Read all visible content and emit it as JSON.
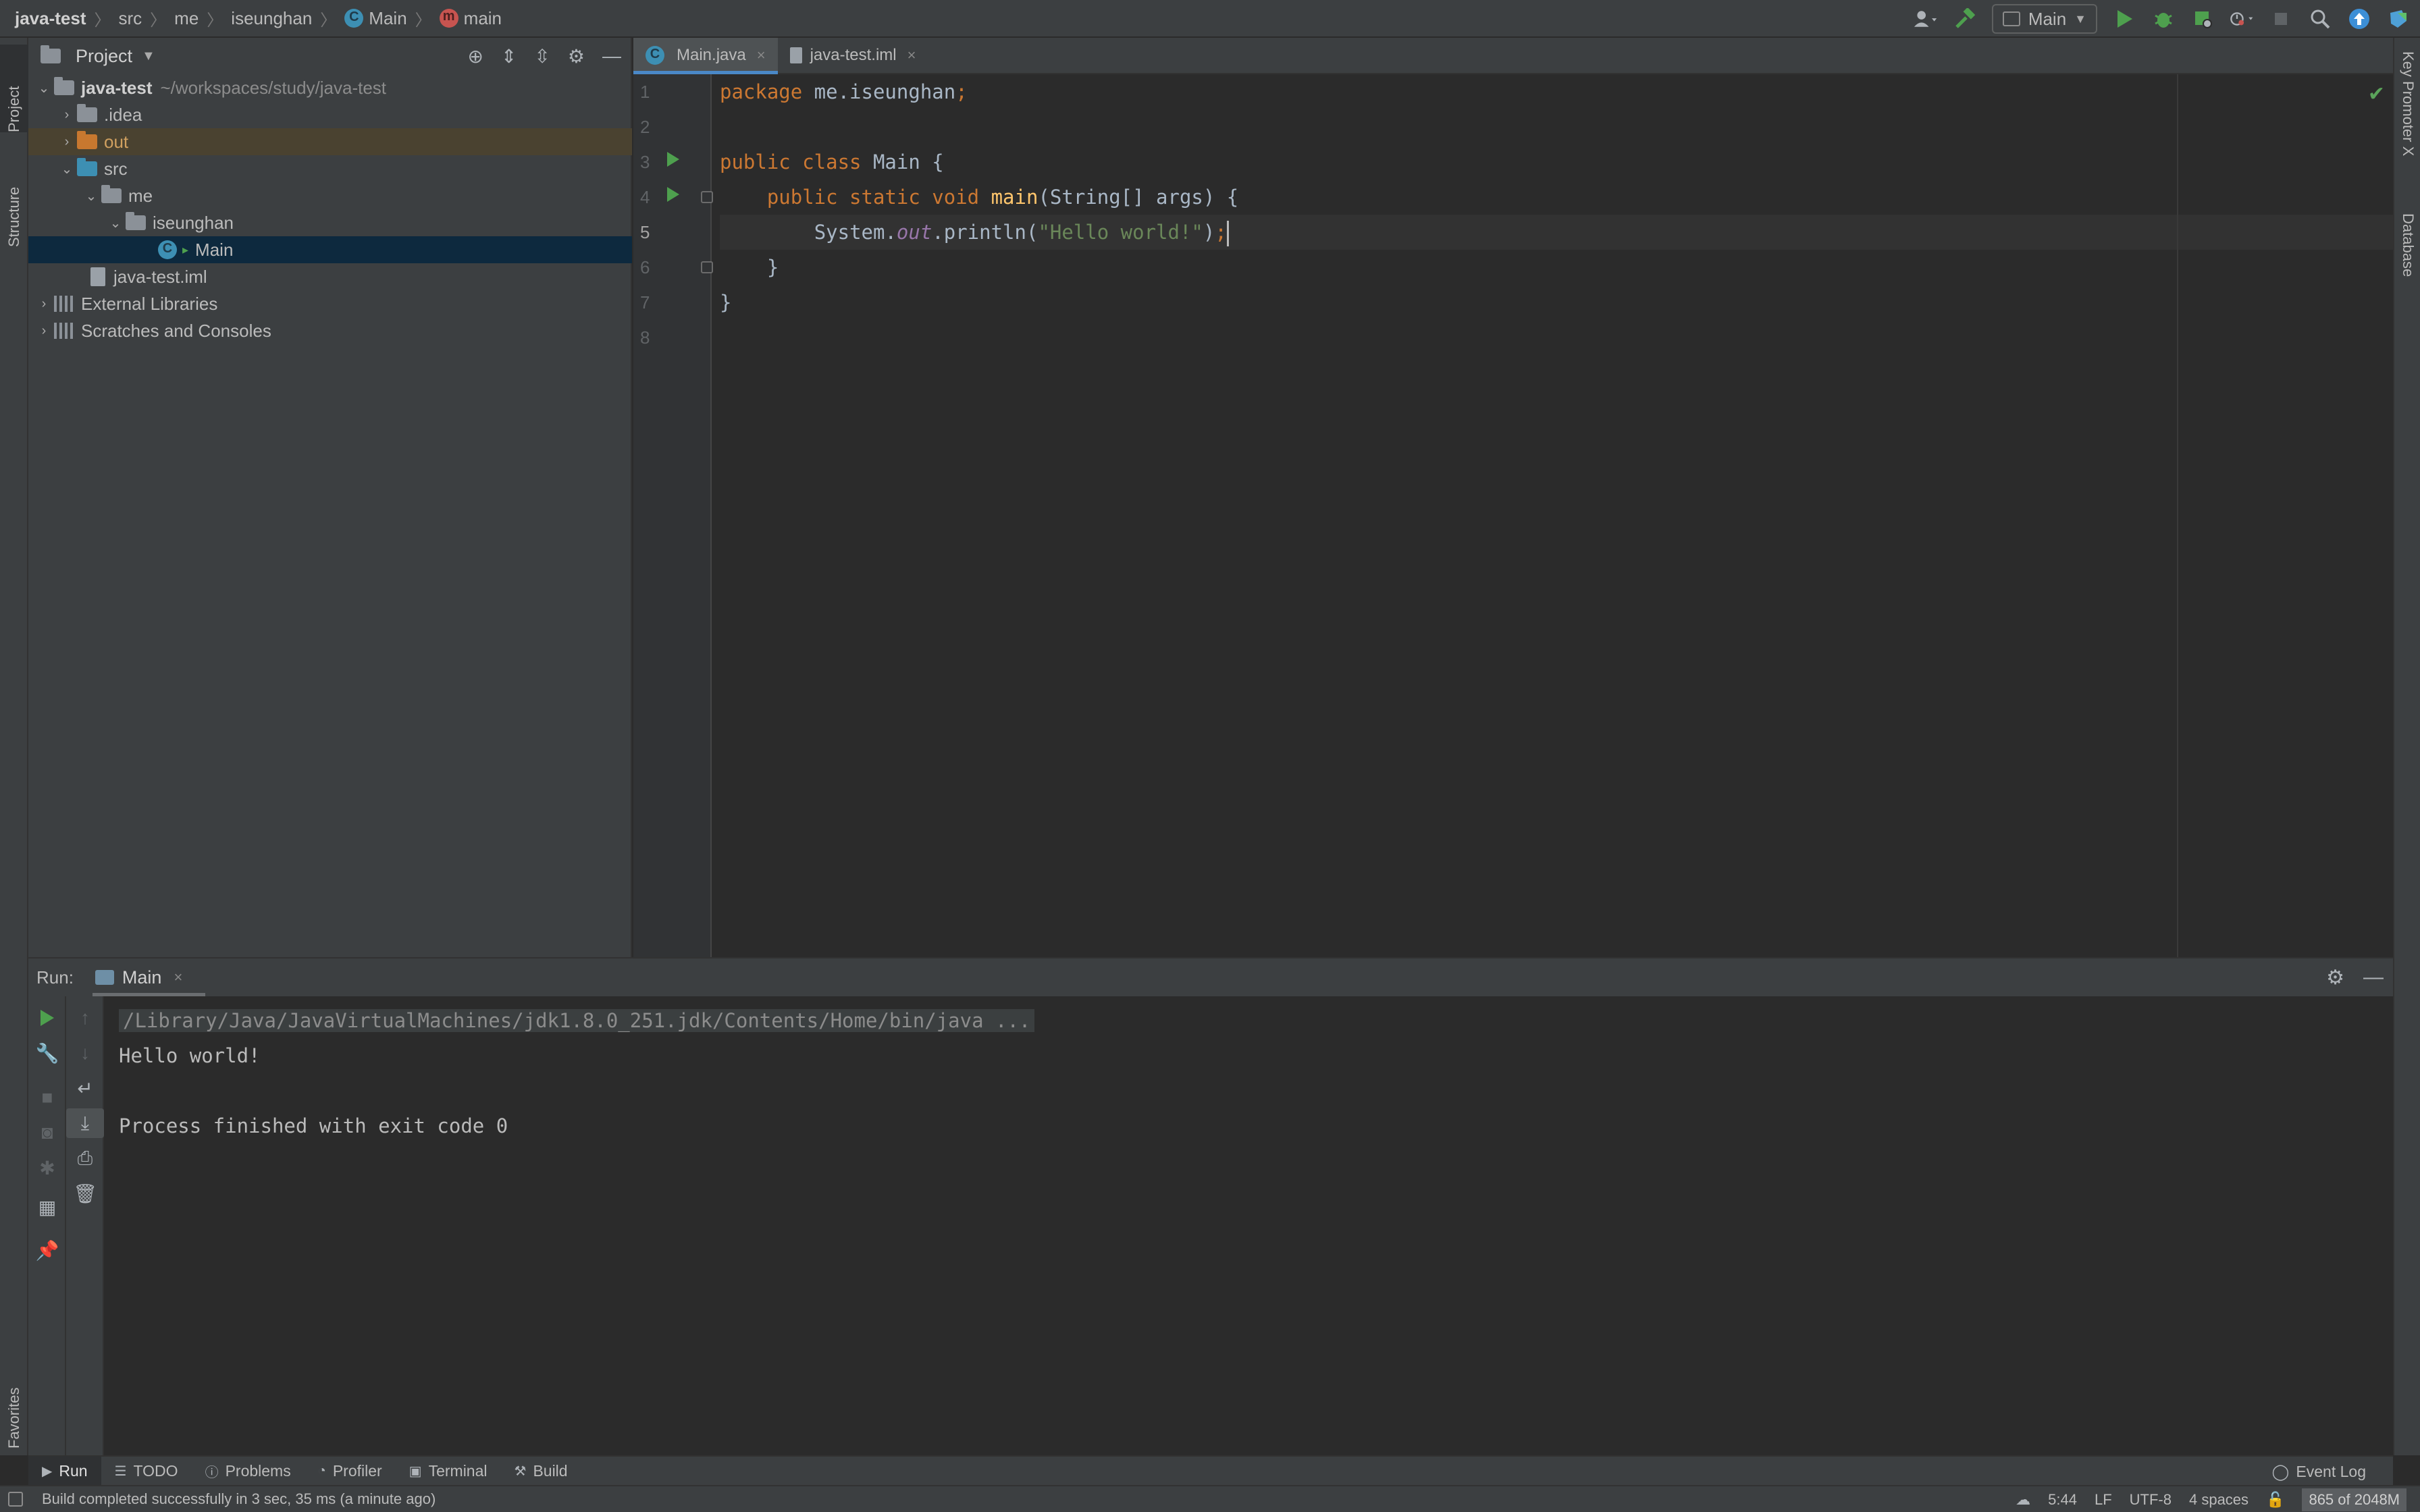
{
  "navbar": {
    "breadcrumb": [
      {
        "label": "java-test",
        "icon": ""
      },
      {
        "label": "src",
        "icon": ""
      },
      {
        "label": "me",
        "icon": ""
      },
      {
        "label": "iseunghan",
        "icon": ""
      },
      {
        "label": "Main",
        "icon": "class-icon"
      },
      {
        "label": "main",
        "icon": "method-icon"
      }
    ],
    "run_config": "Main"
  },
  "left_stripe": {
    "project": "Project",
    "structure": "Structure",
    "favorites": "Favorites"
  },
  "right_stripe": {
    "key_promoter": "Key Promoter X",
    "database": "Database"
  },
  "project_panel": {
    "title": "Project",
    "tree": [
      {
        "name": "java-test",
        "hint": "~/workspaces/study/java-test"
      },
      {
        "name": ".idea"
      },
      {
        "name": "out"
      },
      {
        "name": "src"
      },
      {
        "name": "me"
      },
      {
        "name": "iseunghan"
      },
      {
        "name": "Main"
      },
      {
        "name": "java-test.iml"
      },
      {
        "name": "External Libraries"
      },
      {
        "name": "Scratches and Consoles"
      }
    ]
  },
  "editor": {
    "tabs": [
      {
        "label": "Main.java",
        "active": true
      },
      {
        "label": "java-test.iml",
        "active": false
      }
    ],
    "line_numbers": [
      "1",
      "2",
      "3",
      "4",
      "5",
      "6",
      "7",
      "8"
    ],
    "code": {
      "l1_kw": "package",
      "l1_rest": " me.iseunghan",
      "l1_semi": ";",
      "l3_kw": "public class",
      "l3_rest": " Main {",
      "l4_indent": "    ",
      "l4_kw": "public static void",
      "l4_sp": " ",
      "l4_fn": "main",
      "l4_rest": "(String[] args) {",
      "l5_indent": "        ",
      "l5_a": "System.",
      "l5_field": "out",
      "l5_b": ".println(",
      "l5_str": "\"Hello world!\"",
      "l5_c": ")",
      "l5_semi": ";",
      "l6": "    }",
      "l7": "}"
    }
  },
  "run_panel": {
    "label": "Run:",
    "tab": "Main",
    "console": {
      "command": "/Library/Java/JavaVirtualMachines/jdk1.8.0_251.jdk/Contents/Home/bin/java ...",
      "output": "Hello world!",
      "exit": "Process finished with exit code 0"
    }
  },
  "bottom_tabs": [
    "Run",
    "TODO",
    "Problems",
    "Profiler",
    "Terminal",
    "Build"
  ],
  "event_log": "Event Log",
  "status_bar": {
    "message": "Build completed successfully in 3 sec, 35 ms (a minute ago)",
    "position": "5:44",
    "line_sep": "LF",
    "encoding": "UTF-8",
    "indent": "4 spaces",
    "memory": "865 of 2048M"
  },
  "colors": {
    "accent": "#4a88c7",
    "run_green": "#4ea04e",
    "keyword": "#cc7832",
    "string": "#6a8759"
  }
}
